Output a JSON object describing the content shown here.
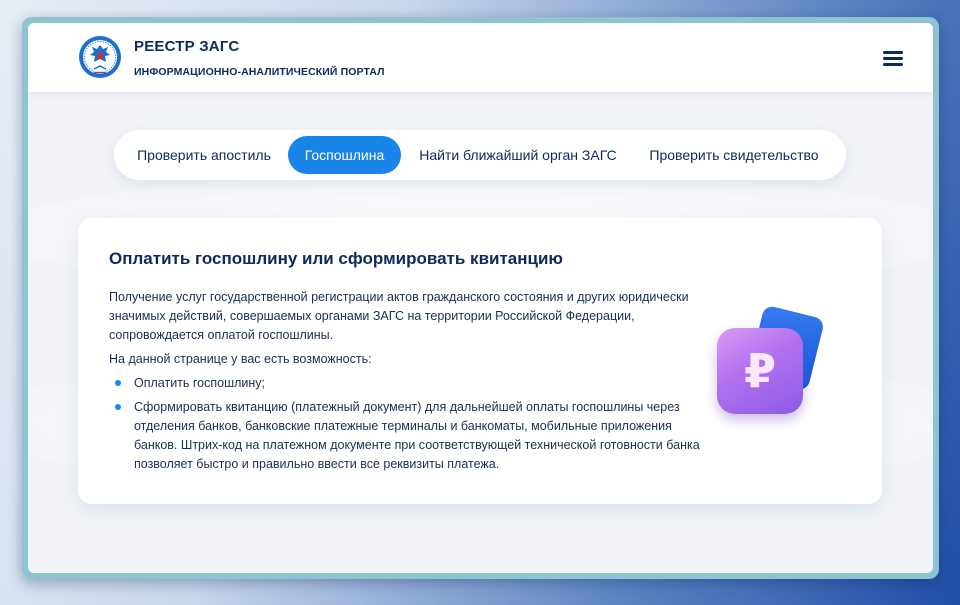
{
  "header": {
    "title": "РЕЕСТР ЗАГС",
    "subtitle": "ИНФОРМАЦИОННО-АНАЛИТИЧЕСКИЙ ПОРТАЛ",
    "logo_icon": "coat-of-arms-emblem",
    "menu_icon": "hamburger-menu-icon"
  },
  "tabs": [
    {
      "label": "Проверить апостиль",
      "active": false
    },
    {
      "label": "Госпошлина",
      "active": true
    },
    {
      "label": "Найти ближайший орган ЗАГС",
      "active": false
    },
    {
      "label": "Проверить свидетельство",
      "active": false
    }
  ],
  "card": {
    "title": "Оплатить госпошлину или сформировать квитанцию",
    "intro": "Получение услуг государственной регистрации актов гражданского состояния и других юридически значимых действий, совершаемых органами ЗАГС на территории Российской Федерации, сопровождается оплатой госпошлины.",
    "possibility": "На данной странице у вас есть возможность:",
    "bullets": [
      "Оплатить госпошлину;",
      "Сформировать квитанцию (платежный документ) для дальнейшей оплаты госпошлины через отделения банков, банковские платежные терминалы и банкоматы, мобильные приложения банков. Штрих-код на платежном документе при соответствующей технической готовности банка позволяет быстро и правильно ввести все реквизиты платежа."
    ],
    "illustration_icon": "ruble-icon",
    "ruble_symbol": "₽"
  },
  "colors": {
    "accent": "#1a85e8",
    "text_dark": "#0d2a5c",
    "ruble_gradient": "#b070ee"
  }
}
